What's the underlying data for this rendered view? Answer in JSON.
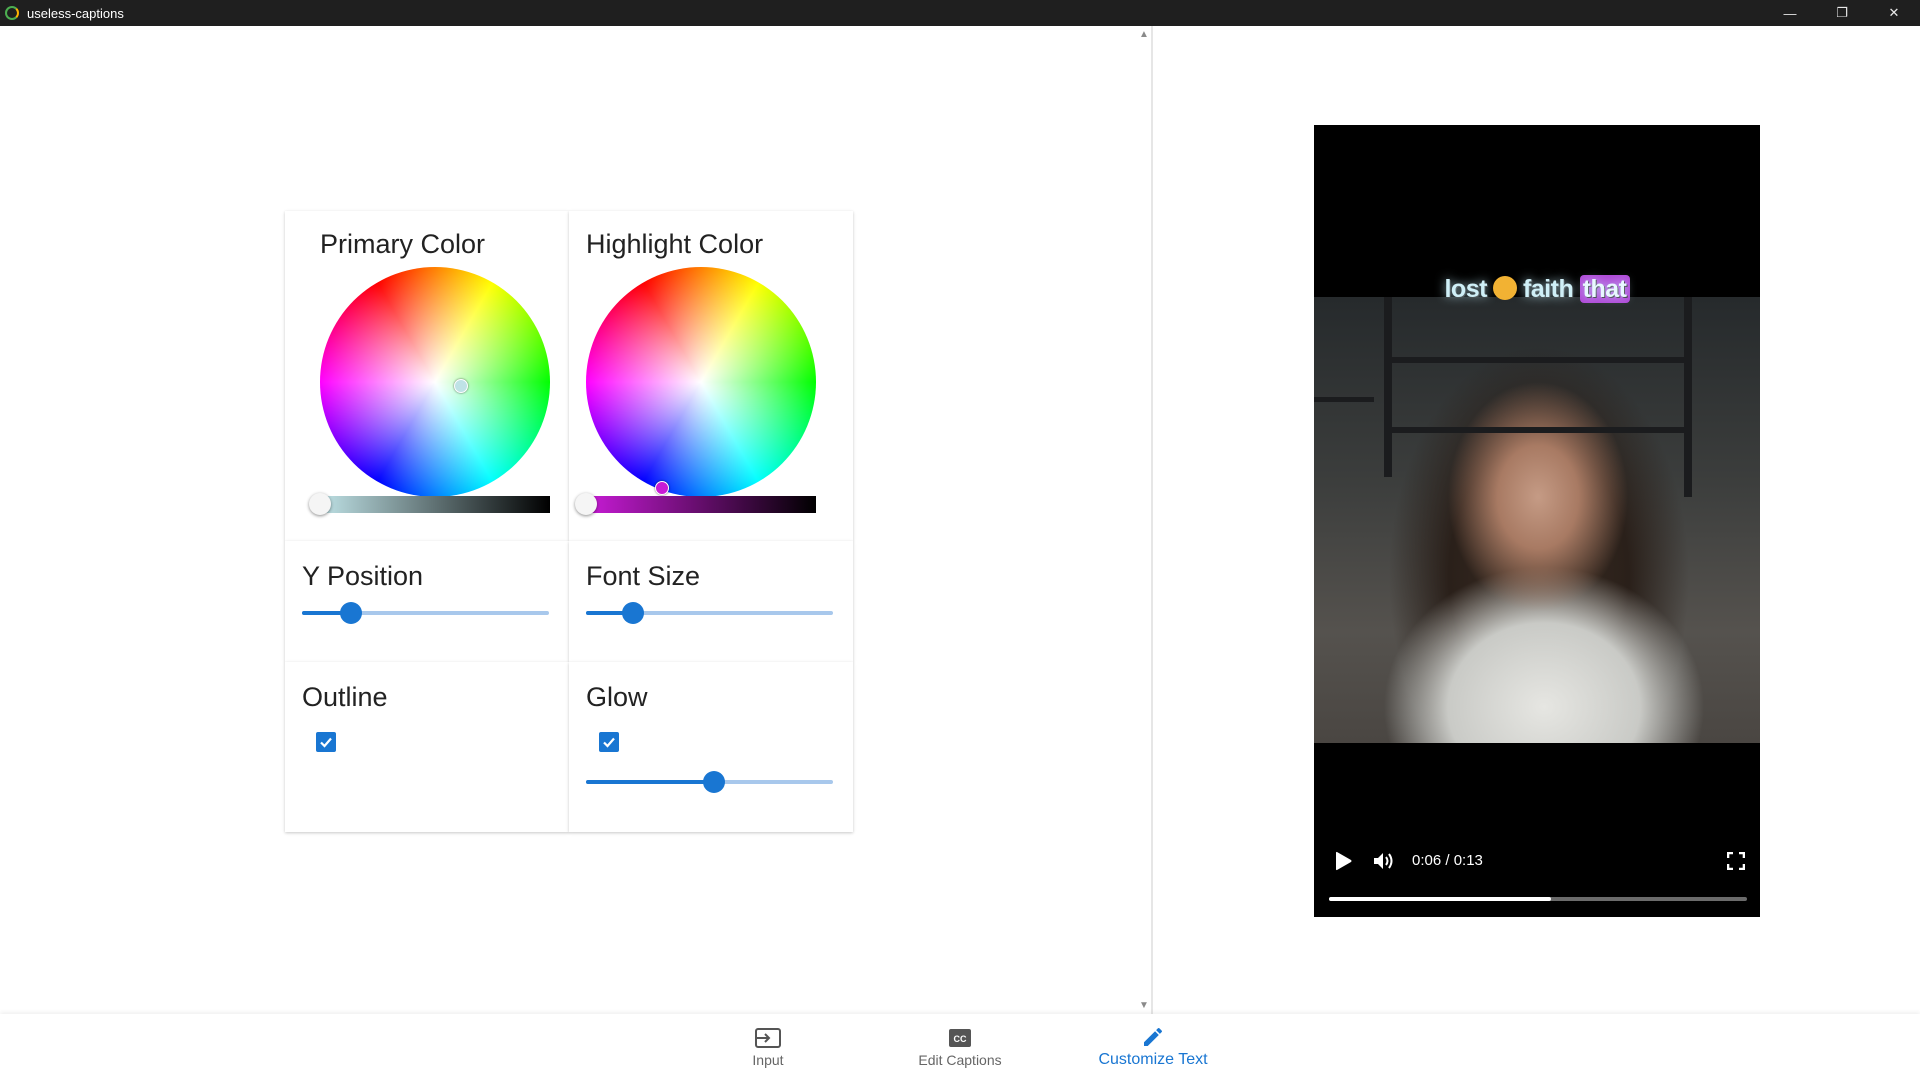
{
  "window": {
    "title": "useless-captions",
    "controls": {
      "minimize": "—",
      "restore": "❐",
      "close": "✕"
    }
  },
  "scroll": {
    "up_glyph": "▲",
    "down_glyph": "▼"
  },
  "cards": {
    "primary_color": {
      "title": "Primary Color",
      "value_fraction": 0.0
    },
    "highlight_color": {
      "title": "Highlight Color",
      "value_fraction": 0.0
    },
    "y_position": {
      "title": "Y Position",
      "value_fraction": 0.2
    },
    "font_size": {
      "title": "Font Size",
      "value_fraction": 0.19
    },
    "outline": {
      "title": "Outline",
      "checked": true
    },
    "glow": {
      "title": "Glow",
      "checked": true,
      "value_fraction": 0.52
    }
  },
  "colors": {
    "accent": "#1976d2",
    "track": "#a8c8ec",
    "highlight": "#b04ad8",
    "primary_value_bar_start": "#bfe2e6",
    "highlight_value_bar_start": "#c81bd6"
  },
  "video": {
    "caption": {
      "word1": "lost",
      "word2": "faith",
      "word3": "that"
    },
    "time_display": "0:06 / 0:13",
    "current_seconds": 6,
    "duration_seconds": 13,
    "progress_fraction": 0.53
  },
  "nav": {
    "items": [
      {
        "label": "Input",
        "icon": "input-icon",
        "active": false
      },
      {
        "label": "Edit Captions",
        "icon": "closed-captions-icon",
        "active": false
      },
      {
        "label": "Customize Text",
        "icon": "pencil-icon",
        "active": true
      }
    ]
  }
}
